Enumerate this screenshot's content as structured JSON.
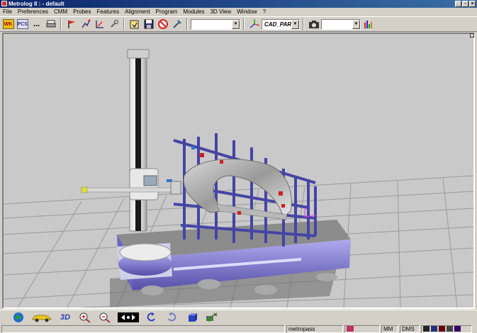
{
  "window": {
    "title": "Metrolog II : - default",
    "controls": [
      "_",
      "▫",
      "×"
    ]
  },
  "menu": [
    "File",
    "Preferences",
    "CMM",
    "Probes",
    "Features",
    "Alignment",
    "Program",
    "Modules",
    "3D View",
    "Window",
    "?"
  ],
  "toolbar": {
    "wk_label": "WK",
    "pcs_label": "PCS",
    "more_label": "...",
    "combo1_value": "",
    "combo2_value": "CAD_PART",
    "combo3_value": ""
  },
  "viewport": {
    "label_3d": "3D"
  },
  "statusbar": {
    "user": "metropass",
    "units": "MM",
    "angle": "DMS"
  },
  "colors": {
    "frame": "#d4d0c8",
    "title_start": "#0a246a",
    "title_end": "#3a6ea5",
    "floor": "#c8c8c8",
    "fixture": "#4b4aa0",
    "base": "#8a85d8"
  }
}
